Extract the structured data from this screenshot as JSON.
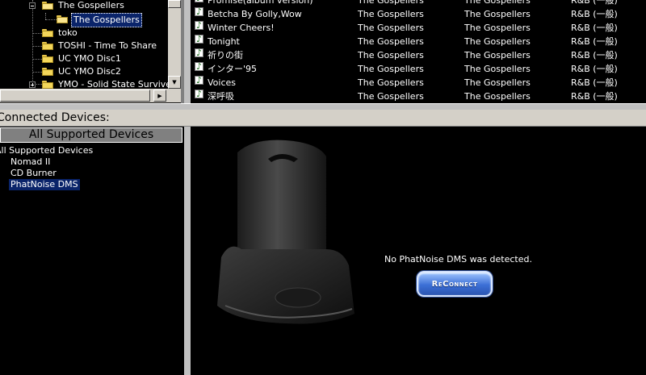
{
  "tree": {
    "items": [
      {
        "label": "The Gospellers",
        "type": "expanded"
      },
      {
        "label": "The Gospellers",
        "type": "selected"
      },
      {
        "label": "toko"
      },
      {
        "label": "TOSHI - Time To Share"
      },
      {
        "label": "UC YMO Disc1"
      },
      {
        "label": "UC YMO Disc2"
      },
      {
        "label": "YMO - Solid State Survive"
      }
    ]
  },
  "tracks": {
    "rows": [
      {
        "title": "Promise(album version)",
        "artist": "The Gospellers",
        "album": "The Gospellers",
        "genre": "R&B (一般)"
      },
      {
        "title": "Betcha By Golly,Wow",
        "artist": "The Gospellers",
        "album": "The Gospellers",
        "genre": "R&B (一般)"
      },
      {
        "title": "Winter Cheers!",
        "artist": "The Gospellers",
        "album": "The Gospellers",
        "genre": "R&B (一般)"
      },
      {
        "title": "Tonight",
        "artist": "The Gospellers",
        "album": "The Gospellers",
        "genre": "R&B (一般)"
      },
      {
        "title": "祈りの街",
        "artist": "The Gospellers",
        "album": "The Gospellers",
        "genre": "R&B (一般)"
      },
      {
        "title": "インター'95",
        "artist": "The Gospellers",
        "album": "The Gospellers",
        "genre": "R&B (一般)"
      },
      {
        "title": "Voices",
        "artist": "The Gospellers",
        "album": "The Gospellers",
        "genre": "R&B (一般)"
      },
      {
        "title": "深呼吸",
        "artist": "The Gospellers",
        "album": "The Gospellers",
        "genre": "R&B (一般)"
      }
    ]
  },
  "devices": {
    "header": "Connected Devices:",
    "tab": "All Supported Devices",
    "root": "All Supported Devices",
    "items": [
      "Nomad II",
      "CD Burner",
      "PhatNoise DMS"
    ]
  },
  "detail": {
    "status": "No PhatNoise DMS was detected.",
    "reconnect_label": "ReConnect"
  },
  "colors": {
    "background": "#000000",
    "selection": "#0a246a",
    "chrome": "#d4d0c8",
    "button_blue": "#3c6fd6"
  }
}
